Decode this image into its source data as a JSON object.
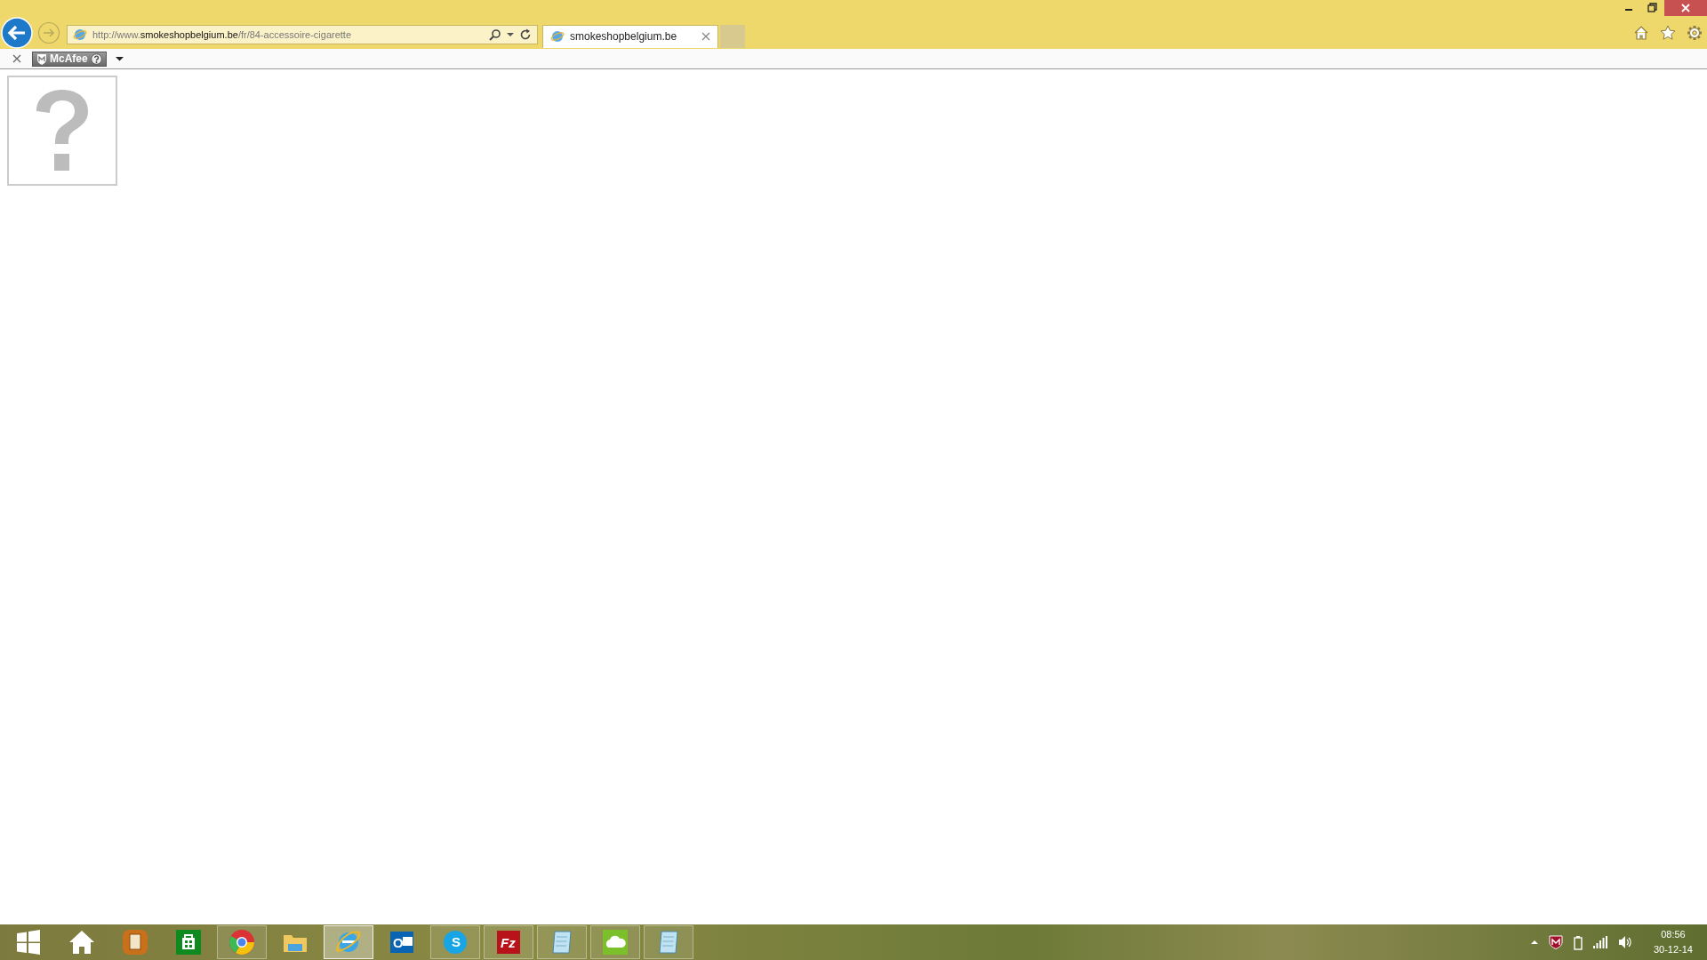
{
  "browser": {
    "address": "http://www.**smokeshopbelgium.be**/fr/84-accessoire-cigarette",
    "tabs": [
      {
        "title": "smokeshopbelgium.be",
        "selected": true
      }
    ],
    "toolbar": {
      "addon_label": "McAfee"
    }
  },
  "page": {
    "broken_image": true
  },
  "taskbar": {
    "items": [
      {
        "kind": "start",
        "running": false,
        "selected": false
      },
      {
        "kind": "home",
        "running": false,
        "selected": false
      },
      {
        "kind": "notes",
        "running": false,
        "selected": false
      },
      {
        "kind": "store",
        "running": false,
        "selected": false
      },
      {
        "kind": "chrome",
        "running": true,
        "selected": false
      },
      {
        "kind": "folder",
        "running": false,
        "selected": false
      },
      {
        "kind": "ie",
        "running": true,
        "selected": true
      },
      {
        "kind": "outlook",
        "running": false,
        "selected": false,
        "badge_text": "O"
      },
      {
        "kind": "skype",
        "running": true,
        "selected": false,
        "badge_text": "S"
      },
      {
        "kind": "filezilla",
        "running": true,
        "selected": false,
        "badge_text": "Fz"
      },
      {
        "kind": "notepad",
        "running": true,
        "selected": false
      },
      {
        "kind": "cloud",
        "running": true,
        "selected": false
      },
      {
        "kind": "notepad",
        "running": true,
        "selected": false
      }
    ],
    "clock": {
      "time": "08:56",
      "date": "30-12-14"
    }
  }
}
